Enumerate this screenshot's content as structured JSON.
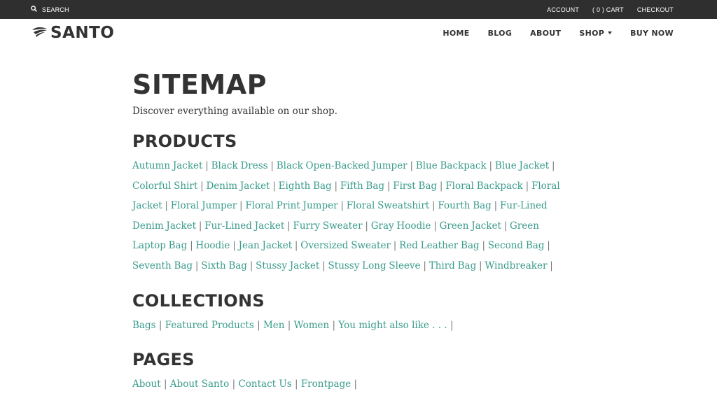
{
  "topbar": {
    "search_label": "SEARCH",
    "account_label": "ACCOUNT",
    "cart_label": "( 0 ) CART",
    "checkout_label": "CHECKOUT"
  },
  "header": {
    "logo_text": "SANTO",
    "nav": [
      {
        "label": "HOME"
      },
      {
        "label": "BLOG"
      },
      {
        "label": "ABOUT"
      },
      {
        "label": "SHOP"
      },
      {
        "label": "BUY NOW"
      }
    ]
  },
  "main": {
    "title": "SITEMAP",
    "intro": "Discover everything available on our shop.",
    "separator": "|",
    "sections": [
      {
        "title": "PRODUCTS",
        "links": [
          "Autumn Jacket",
          "Black Dress",
          "Black Open-Backed Jumper",
          "Blue Backpack",
          "Blue Jacket",
          "Colorful Shirt",
          "Denim Jacket",
          "Eighth Bag",
          "Fifth Bag",
          "First Bag",
          "Floral Backpack",
          "Floral Jacket",
          "Floral Jumper",
          "Floral Print Jumper",
          "Floral Sweatshirt",
          "Fourth Bag",
          "Fur-Lined Denim Jacket",
          "Fur-Lined Jacket",
          "Furry Sweater",
          "Gray Hoodie",
          "Green Jacket",
          "Green Laptop Bag",
          "Hoodie",
          "Jean Jacket",
          "Oversized Sweater",
          "Red Leather Bag",
          "Second Bag",
          "Seventh Bag",
          "Sixth Bag",
          "Stussy Jacket",
          "Stussy Long Sleeve",
          "Third Bag",
          "Windbreaker"
        ]
      },
      {
        "title": "COLLECTIONS",
        "links": [
          "Bags",
          "Featured Products",
          "Men",
          "Women",
          "You might also like . . ."
        ]
      },
      {
        "title": "PAGES",
        "links": [
          "About",
          "About Santo",
          "Contact Us",
          "Frontpage"
        ]
      }
    ]
  },
  "colors": {
    "topbar_bg": "#2f2f2f",
    "link": "#3a9b8c",
    "text": "#333333"
  }
}
